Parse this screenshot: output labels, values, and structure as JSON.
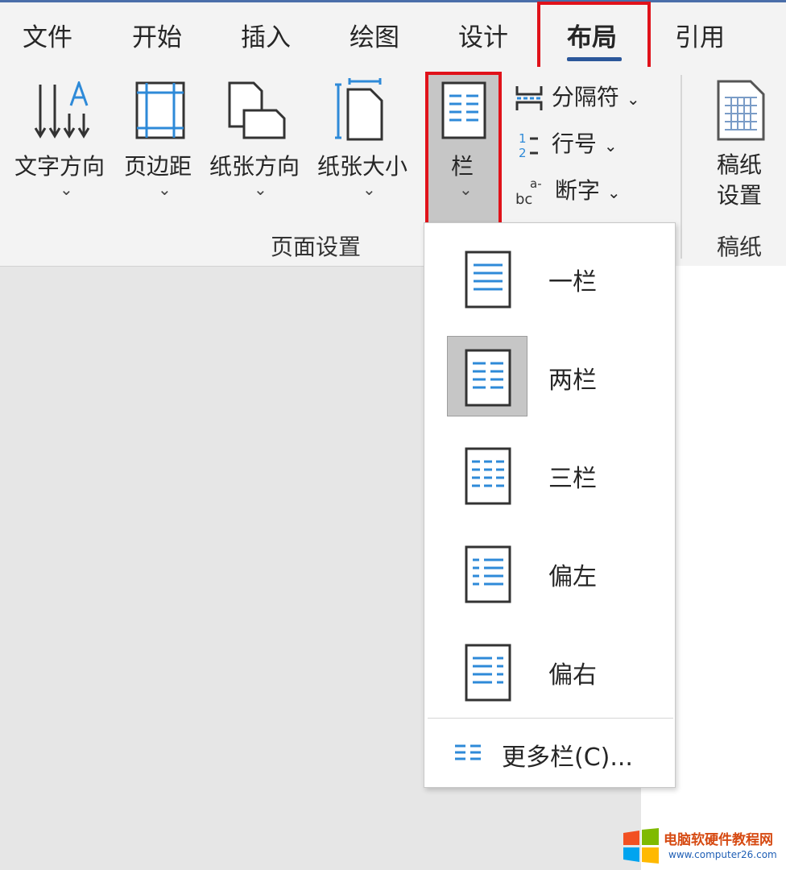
{
  "tabs": [
    {
      "label": "文件",
      "active": false
    },
    {
      "label": "开始",
      "active": false
    },
    {
      "label": "插入",
      "active": false
    },
    {
      "label": "绘图",
      "active": false
    },
    {
      "label": "设计",
      "active": false
    },
    {
      "label": "布局",
      "active": true
    },
    {
      "label": "引用",
      "active": false
    }
  ],
  "ribbon": {
    "text_direction": "文字方向",
    "margins": "页边距",
    "orientation": "纸张方向",
    "size": "纸张大小",
    "columns": "栏",
    "breaks": "分隔符",
    "line_numbers": "行号",
    "hyphenation": "断字",
    "manuscript_setup_1": "稿纸",
    "manuscript_setup_2": "设置",
    "page_setup_group": "页面设置",
    "manuscript_group": "稿纸"
  },
  "columns_menu": {
    "items": [
      {
        "label": "一栏",
        "icon": "one-column-icon",
        "selected": false
      },
      {
        "label": "两栏",
        "icon": "two-columns-icon",
        "selected": true
      },
      {
        "label": "三栏",
        "icon": "three-columns-icon",
        "selected": false
      },
      {
        "label": "偏左",
        "icon": "left-column-icon",
        "selected": false
      },
      {
        "label": "偏右",
        "icon": "right-column-icon",
        "selected": false
      }
    ],
    "more_columns": "更多栏(C)..."
  },
  "watermark": {
    "name": "电脑软硬件教程网",
    "url": "www.computer26.com"
  },
  "colors": {
    "accent": "#2b579a",
    "highlight_red": "#e0121a",
    "icon_blue": "#2e8ad8"
  }
}
